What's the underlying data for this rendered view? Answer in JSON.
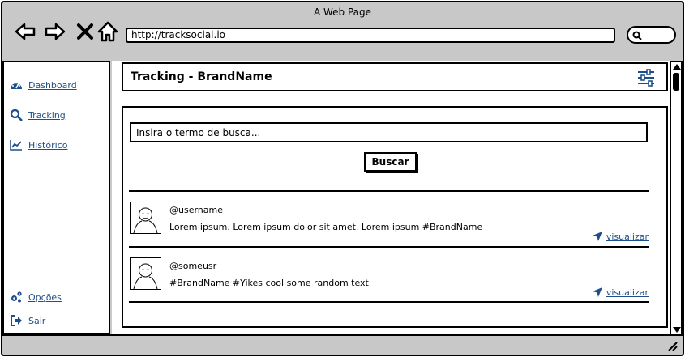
{
  "window": {
    "title": "A Web Page"
  },
  "browser": {
    "url": "http://tracksocial.io",
    "icons": [
      "back-arrow-icon",
      "forward-arrow-icon",
      "close-icon",
      "home-icon",
      "search-icon"
    ]
  },
  "sidebar": {
    "items": [
      {
        "label": "Dashboard",
        "icon": "dashboard-icon"
      },
      {
        "label": "Tracking",
        "icon": "search-icon"
      },
      {
        "label": "Histórico",
        "icon": "chart-line-icon"
      }
    ],
    "bottom_items": [
      {
        "label": "Opções",
        "icon": "gears-icon"
      },
      {
        "label": "Sair",
        "icon": "sign-out-icon"
      }
    ]
  },
  "header": {
    "title": "Tracking - BrandName",
    "icon": "sliders-icon"
  },
  "search": {
    "placeholder": "Insira o termo de busca...",
    "button_label": "Buscar"
  },
  "posts": [
    {
      "user": "@username",
      "text": "Lorem ipsum. Lorem ipsum dolor sit amet. Lorem ipsum #BrandName",
      "link_label": "visualizar"
    },
    {
      "user": "@someusr",
      "text": "#BrandName #Yikes cool some random text",
      "link_label": "visualizar"
    }
  ],
  "colors": {
    "link": "#1f4f8a",
    "chrome": "#c8c8c8"
  }
}
